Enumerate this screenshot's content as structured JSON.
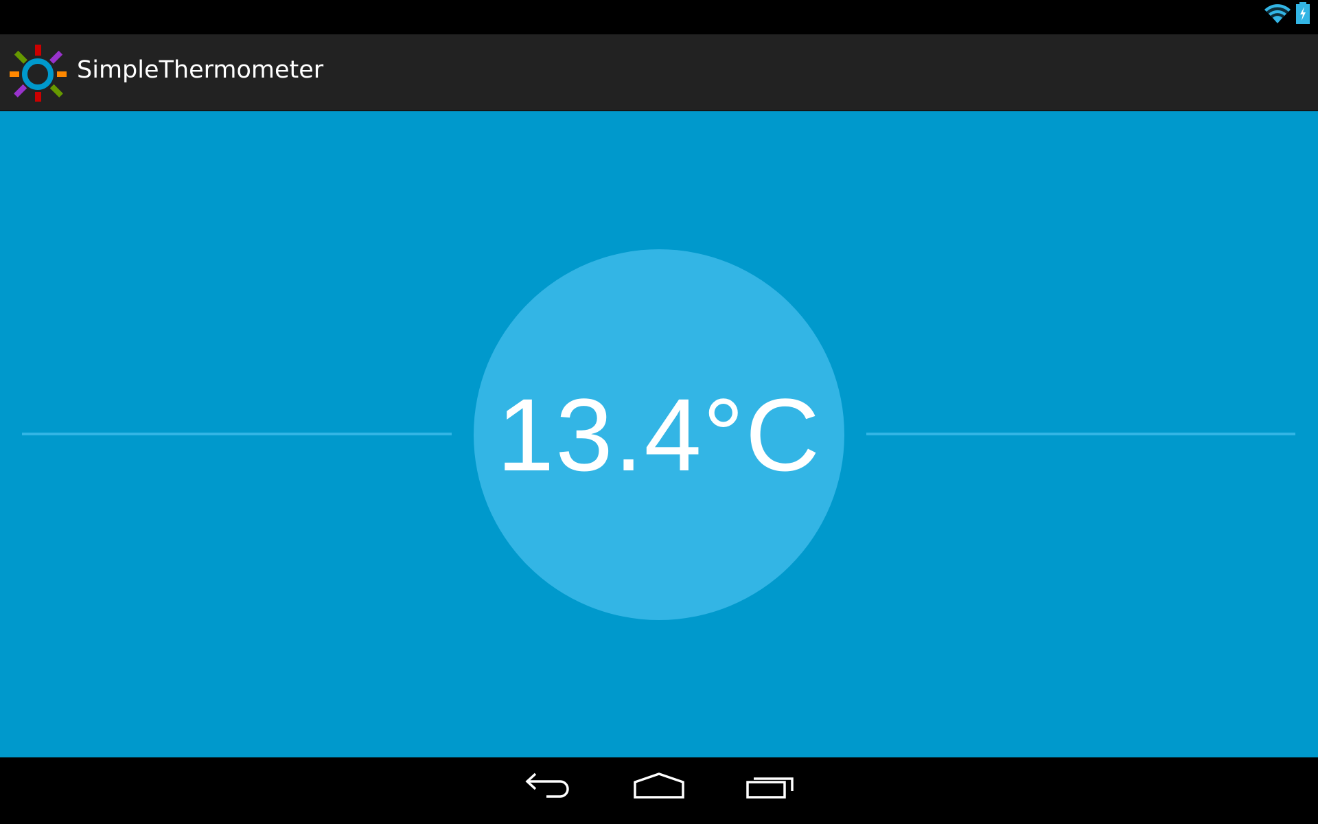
{
  "status_bar": {
    "icons": [
      "wifi-icon",
      "battery-charging-icon"
    ],
    "accent": "#33b5e5"
  },
  "action_bar": {
    "title": "SimpleThermometer",
    "icon": "app-sun-icon"
  },
  "main": {
    "temperature": "13.4°C",
    "background": "#0099cc",
    "circle_color": "#33b5e5"
  },
  "nav_bar": {
    "buttons": [
      "back",
      "home",
      "recent-apps"
    ]
  }
}
